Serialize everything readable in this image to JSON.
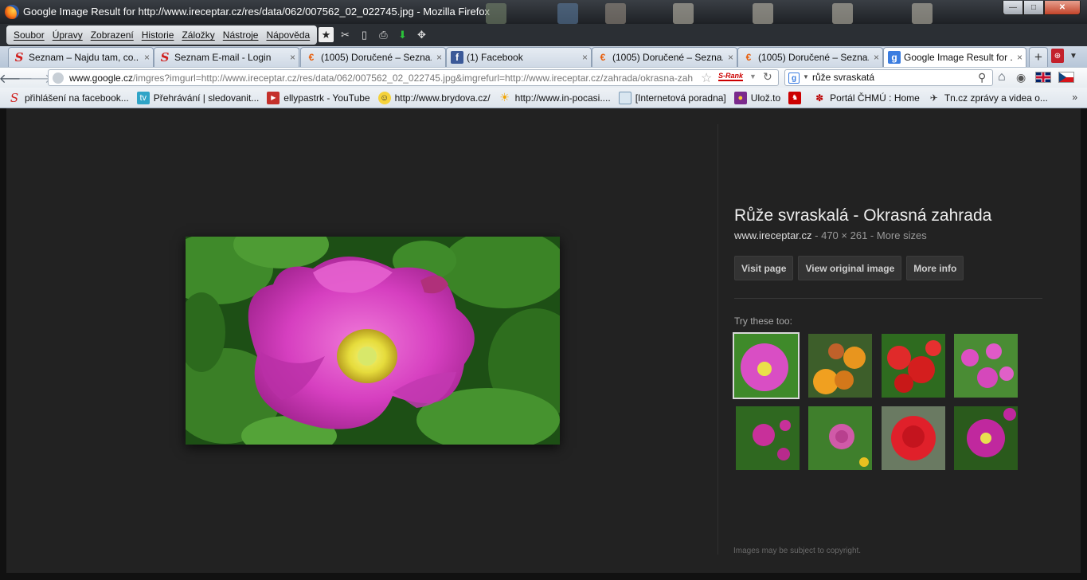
{
  "window": {
    "title": "Google Image Result for http://www.ireceptar.cz/res/data/062/007562_02_022745.jpg - Mozilla Firefox",
    "minimize": "—",
    "maximize": "□",
    "close": "✕"
  },
  "menubar": {
    "items": [
      "Soubor",
      "Úpravy",
      "Zobrazení",
      "Historie",
      "Záložky",
      "Nástroje",
      "Nápověda"
    ]
  },
  "tabs": [
    {
      "label": "Seznam – Najdu tam, co...",
      "icon": "seznam-s-icon",
      "active": false
    },
    {
      "label": "Seznam E-mail - Login",
      "icon": "seznam-s-icon",
      "active": false
    },
    {
      "label": "(1005) Doručené – Sezna...",
      "icon": "email-e-icon",
      "active": false
    },
    {
      "label": "(1) Facebook",
      "icon": "facebook-icon",
      "active": false
    },
    {
      "label": "(1005) Doručené – Sezna...",
      "icon": "email-e-icon",
      "active": false
    },
    {
      "label": "(1005) Doručené – Sezna...",
      "icon": "email-e-icon",
      "active": false
    },
    {
      "label": "Google Image Result for ...",
      "icon": "google-icon",
      "active": true
    }
  ],
  "tab_close_glyph": "×",
  "navbar": {
    "url_domain": "www.google.cz",
    "url_rest": "/imgres?imgurl=http://www.ireceptar.cz/res/data/062/007562_02_022745.jpg&imgrefurl=http://www.ireceptar.cz/zahrada/okrasna-zah",
    "srank": "S-Rank",
    "search_value": "růže svraskatá",
    "search_engine": "g"
  },
  "bookmarks": [
    {
      "label": "přihlášení na facebook...",
      "icon": "seznam-s-icon"
    },
    {
      "label": "Přehrávání | sledovanit...",
      "icon": "tv-icon"
    },
    {
      "label": "ellypastrk - YouTube",
      "icon": "youtube-icon"
    },
    {
      "label": "http://www.brydova.cz/",
      "icon": "smiley-icon"
    },
    {
      "label": "http://www.in-pocasi....",
      "icon": "sun-icon"
    },
    {
      "label": "[Internetová poradna]",
      "icon": "page-icon"
    },
    {
      "label": "Ulož.to",
      "icon": "uloz-to-icon"
    },
    {
      "label": "Portál ČHMÚ : Home",
      "icon": "chmu-icon"
    },
    {
      "label": "Tn.cz zprávy a videa o...",
      "icon": "tn-icon"
    }
  ],
  "bookmarks_more": "»",
  "result": {
    "title": "Růže svraskalá - Okrasná zahrada",
    "domain": "www.ireceptar.cz",
    "dims": " - 470 × 261 - ",
    "more_sizes": "More sizes",
    "buttons": {
      "visit": "Visit page",
      "original": "View original image",
      "more_info": "More info"
    },
    "try_label": "Try these too:",
    "copyright": "Images may be subject to copyright."
  },
  "colors": {
    "page_bg": "#222222",
    "rose_pink": "#d63fc0",
    "leaf_green": "#2f6e1f"
  }
}
